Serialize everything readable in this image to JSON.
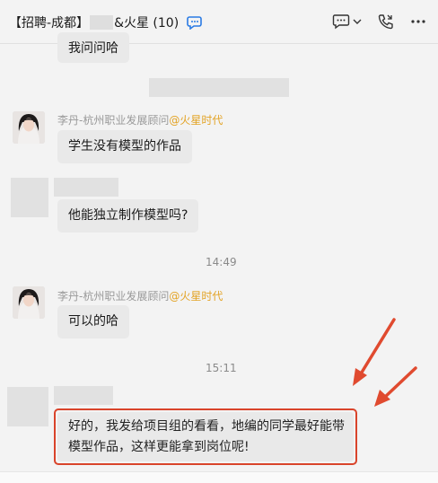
{
  "header": {
    "title_prefix": "【招聘-成都】",
    "title_suffix": "&火星 (10)",
    "icons": [
      "chat-bubble-icon",
      "chevron-down-icon",
      "phone-icon",
      "more-icon"
    ]
  },
  "messages": {
    "m0_text": "我问问哈",
    "m1_sender": "李丹-杭州职业发展顾问",
    "m1_org": "@火星时代",
    "m1_text": "学生没有模型的作品",
    "m2_text": "他能独立制作模型吗?",
    "time1": "14:49",
    "m3_sender": "李丹-杭州职业发展顾问",
    "m3_org": "@火星时代",
    "m3_text": "可以的哈",
    "time2": "15:11",
    "m4_line1": "好的，我发给项目组的看看，地编的同学最好能带",
    "m4_line2": "模型作品，这样更能拿到岗位呢!"
  },
  "colors": {
    "accent_org": "#e3a325",
    "highlight_red": "#d9442b",
    "arrow_red": "#e04a2f"
  }
}
